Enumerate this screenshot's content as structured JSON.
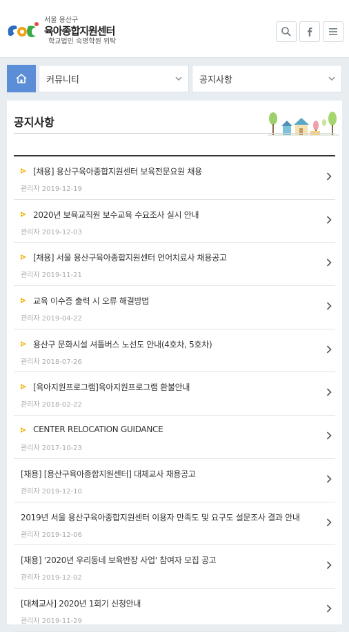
{
  "header": {
    "logo_sub": "서울 용산구",
    "logo_title": "육아종합지원센터",
    "logo_org": "학교법인 숙명학원 위탁",
    "icons": [
      "search-icon",
      "facebook-icon",
      "menu-icon"
    ],
    "accent": "#5b8ed6"
  },
  "nav": {
    "home_icon": "home-icon",
    "category": "커뮤니티",
    "page": "공지사항"
  },
  "board": {
    "title": "공지사항",
    "items": [
      {
        "title": "[채용] 용산구육아종합지원센터 보육전문요원 채용",
        "meta": "관리자 2019-12-19",
        "notice": true
      },
      {
        "title": "2020년 보육교직원 보수교육 수요조사 실시 안내",
        "meta": "관리자 2019-12-03",
        "notice": true
      },
      {
        "title": "[채용] 서울 용산구육아종합지원센터 언어치료사 채용공고",
        "meta": "관리자 2019-11-21",
        "notice": true
      },
      {
        "title": "교육 이수증 출력 시 오류 해결방법",
        "meta": "관리자 2019-04-22",
        "notice": true
      },
      {
        "title": "용산구 문화시설 셔틀버스 노선도 안내(4호차, 5호차)",
        "meta": "관리자 2018-07-26",
        "notice": true
      },
      {
        "title": "[육아지원프로그램]육아지원프로그램 환불안내",
        "meta": "관리자 2018-02-22",
        "notice": true
      },
      {
        "title": "CENTER RELOCATION GUIDANCE",
        "meta": "관리자 2017-10-23",
        "notice": true
      },
      {
        "title": "[채용] [용산구육아종합지원센터] 대체교사 채용공고",
        "meta": "관리자 2019-12-10",
        "notice": false
      },
      {
        "title": "2019년 서울 용산구육아종합지원센터 이용자 만족도 및 요구도 설문조사 결과 안내",
        "meta": "관리자 2019-12-06",
        "notice": false
      },
      {
        "title": "[채용] '2020년 우리동네 보육반장 사업' 참여자 모집 공고",
        "meta": "관리자 2019-12-02",
        "notice": false
      },
      {
        "title": "[대체교사] 2020년 1회기 신청안내",
        "meta": "관리자 2019-11-29",
        "notice": false
      }
    ]
  }
}
